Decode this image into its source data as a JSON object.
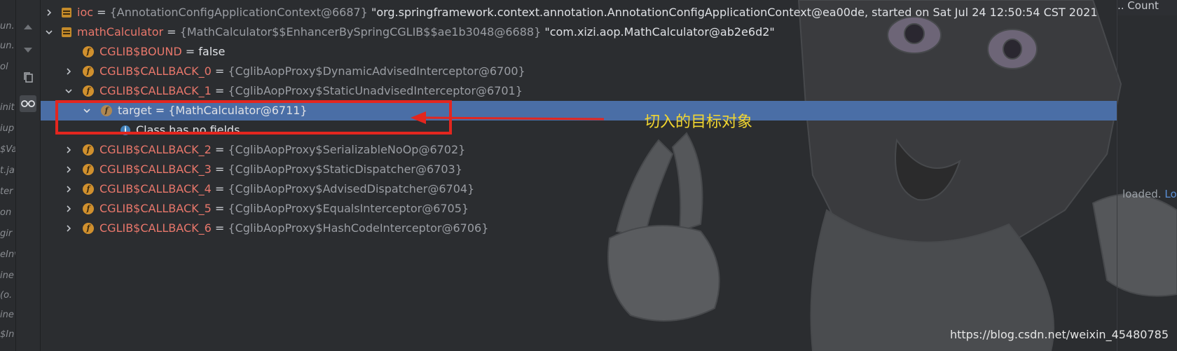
{
  "gutter_fragments": [
    "un.",
    "un.",
    "ol",
    "init",
    "iup",
    "$Va",
    "t.ja",
    "ter",
    "on",
    "gir",
    "eInv",
    "ine",
    "(o.",
    "ine",
    "$In"
  ],
  "tools": [
    {
      "icon": "arrow-up-icon"
    },
    {
      "icon": "arrow-down-icon"
    },
    {
      "icon": "copy-icon"
    },
    {
      "icon": "glasses-icon"
    }
  ],
  "rows": [
    {
      "name": "ioc",
      "type": "{AnnotationConfigApplicationContext@6687}",
      "value": "\"org.springframework.context.annotation.AnnotationConfigApplicationContext@ea00de, started on Sat Jul 24 12:50:54 CST 2021"
    },
    {
      "name": "mathCalculator",
      "type": "{MathCalculator$$EnhancerBySpringCGLIB$$ae1b3048@6688}",
      "value": "\"com.xizi.aop.MathCalculator@ab2e6d2\""
    },
    {
      "name": "CGLIB$BOUND",
      "value": "false"
    },
    {
      "name": "CGLIB$CALLBACK_0",
      "type": "{CglibAopProxy$DynamicAdvisedInterceptor@6700}"
    },
    {
      "name": "CGLIB$CALLBACK_1",
      "type": "{CglibAopProxy$StaticUnadvisedInterceptor@6701}"
    },
    {
      "name": "target",
      "type": "{MathCalculator@6711}"
    },
    {
      "text": "Class has no fields"
    },
    {
      "name": "CGLIB$CALLBACK_2",
      "type": "{CglibAopProxy$SerializableNoOp@6702}"
    },
    {
      "name": "CGLIB$CALLBACK_3",
      "type": "{CglibAopProxy$StaticDispatcher@6703}"
    },
    {
      "name": "CGLIB$CALLBACK_4",
      "type": "{CglibAopProxy$AdvisedDispatcher@6704}"
    },
    {
      "name": "CGLIB$CALLBACK_5",
      "type": "{CglibAopProxy$EqualsInterceptor@6705}"
    },
    {
      "name": "CGLIB$CALLBACK_6",
      "type": "{CglibAopProxy$HashCodeInterceptor@6706}"
    }
  ],
  "field_icon_letter": "f",
  "info_icon_letter": "i",
  "equals": "=",
  "right_header": "..  Count",
  "loaded_text": "loaded.",
  "loaded_link": "Lo",
  "annotation": "切入的目标对象",
  "watermark": "https://blog.csdn.net/weixin_45480785",
  "colors": {
    "background": "#2b2d30",
    "selection": "#4a6ea6",
    "field_name": "#e8776b",
    "annotation_box": "#e3261f",
    "annotation_text": "#f2d630"
  }
}
